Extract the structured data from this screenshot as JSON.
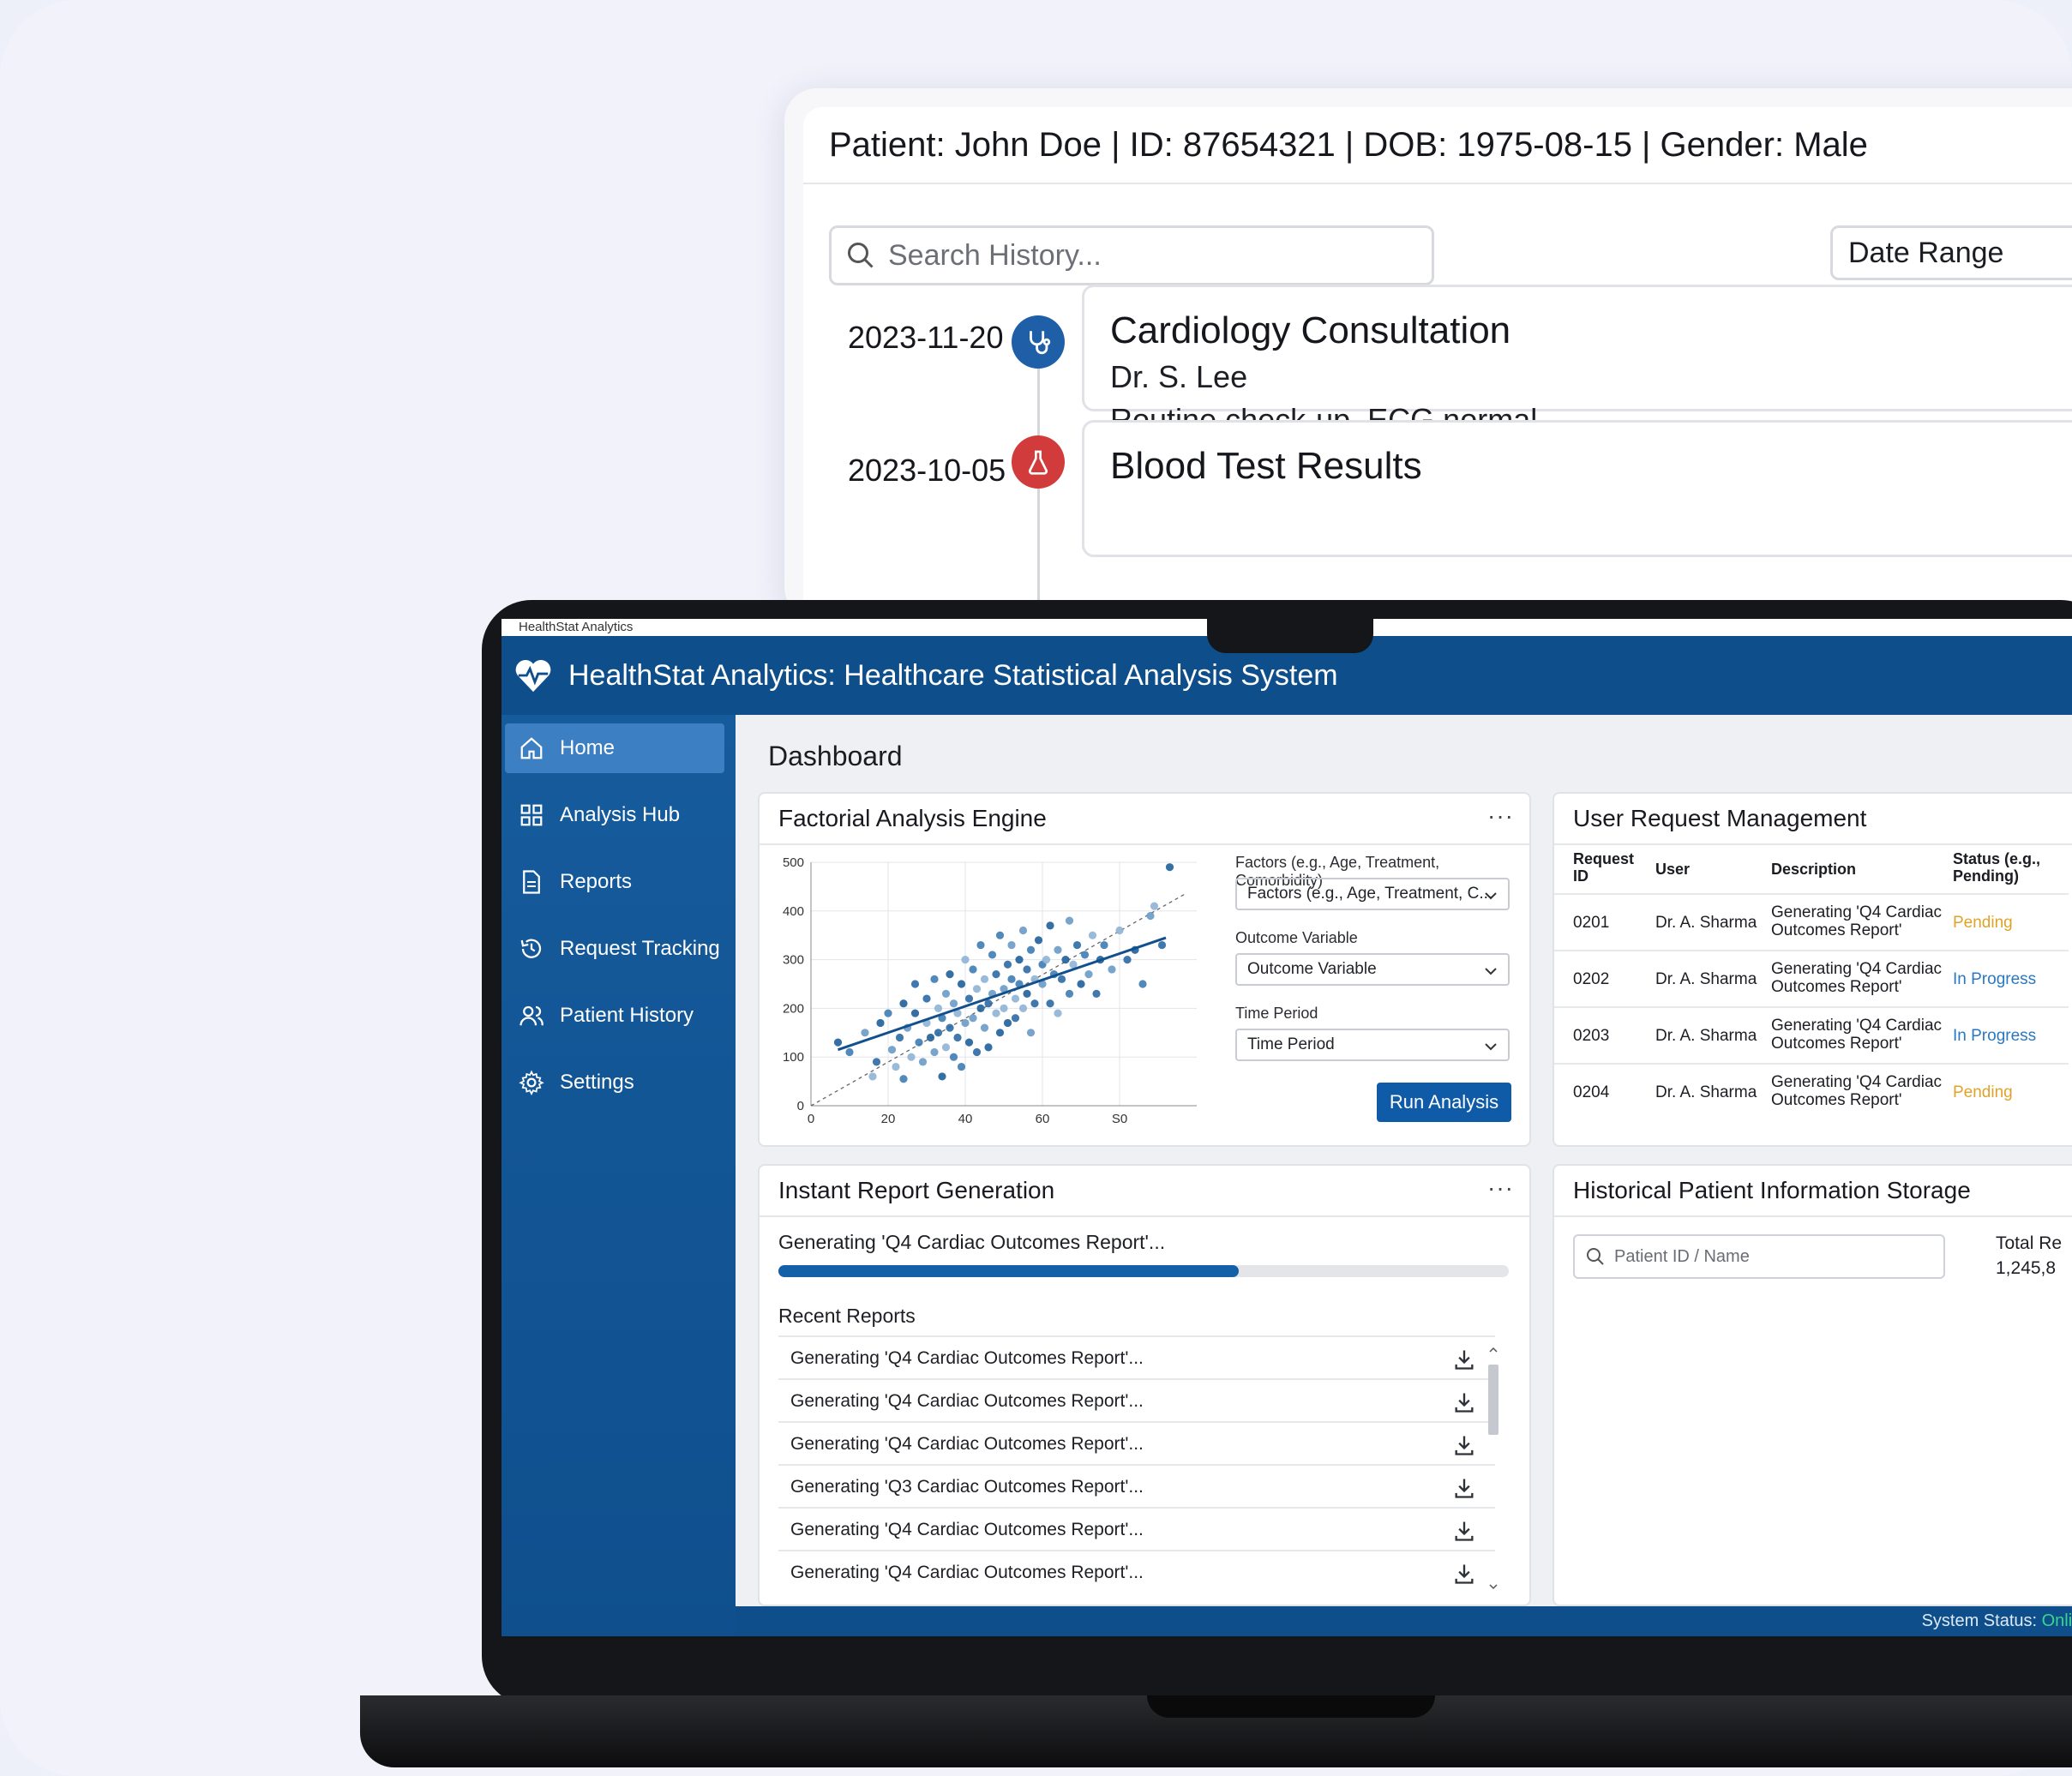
{
  "history": {
    "patient_header": "Patient: John Doe | ID: 87654321 | DOB: 1975-08-15 | Gender: Male",
    "search_placeholder": "Search History...",
    "date_range_label": "Date Range",
    "events": [
      {
        "date": "2023-11-20",
        "icon": "stethoscope-icon",
        "icon_color": "#1f5fa8",
        "title": "Cardiology Consultation",
        "doctor": "Dr. S. Lee",
        "note": "Routine check-up, ECG normal."
      },
      {
        "date": "2023-10-05",
        "icon": "flask-icon",
        "icon_color": "#d23b3b",
        "title": "Blood Test Results",
        "doctor": "",
        "note": ""
      }
    ]
  },
  "app": {
    "window_caption": "HealthStat Analytics",
    "title": "HealthStat Analytics: Healthcare Statistical Analysis System",
    "nav": [
      {
        "label": "Home",
        "icon": "home-icon",
        "active": true
      },
      {
        "label": "Analysis Hub",
        "icon": "grid-icon",
        "active": false
      },
      {
        "label": "Reports",
        "icon": "document-icon",
        "active": false
      },
      {
        "label": "Request Tracking",
        "icon": "history-icon",
        "active": false
      },
      {
        "label": "Patient History",
        "icon": "users-icon",
        "active": false
      },
      {
        "label": "Settings",
        "icon": "gear-icon",
        "active": false
      }
    ],
    "dashboard_title": "Dashboard",
    "status_label": "System Status:",
    "status_value": "Online"
  },
  "factorial": {
    "title": "Factorial Analysis Engine",
    "menu": "···",
    "factors_label": "Factors (e.g., Age, Treatment, Comorbidity)",
    "factors_value": "Factors (e.g., Age, Treatment, C...",
    "outcome_label": "Outcome Variable",
    "outcome_value": "Outcome Variable",
    "period_label": "Time Period",
    "period_value": "Time Period",
    "run_label": "Run Analysis"
  },
  "chart_data": {
    "type": "scatter",
    "title": "",
    "xlabel": "",
    "ylabel": "",
    "x_ticks": [
      "0",
      "20",
      "40",
      "60",
      "S0"
    ],
    "y_ticks": [
      "0",
      "100",
      "200",
      "300",
      "400",
      "500"
    ],
    "xlim": [
      0,
      100
    ],
    "ylim": [
      0,
      500
    ],
    "grid": true,
    "trend_line": {
      "x": [
        7,
        92
      ],
      "y": [
        115,
        345
      ]
    },
    "reference_line": {
      "x": [
        0,
        97
      ],
      "y": [
        0,
        435
      ]
    },
    "points": [
      [
        7,
        130
      ],
      [
        10,
        110
      ],
      [
        14,
        150
      ],
      [
        16,
        60
      ],
      [
        17,
        90
      ],
      [
        18,
        170
      ],
      [
        20,
        190
      ],
      [
        21,
        115
      ],
      [
        22,
        80
      ],
      [
        23,
        140
      ],
      [
        24,
        210
      ],
      [
        24,
        55
      ],
      [
        25,
        160
      ],
      [
        26,
        100
      ],
      [
        27,
        250
      ],
      [
        27,
        190
      ],
      [
        28,
        130
      ],
      [
        29,
        90
      ],
      [
        30,
        170
      ],
      [
        30,
        220
      ],
      [
        31,
        140
      ],
      [
        32,
        260
      ],
      [
        32,
        110
      ],
      [
        33,
        200
      ],
      [
        33,
        150
      ],
      [
        34,
        60
      ],
      [
        34,
        180
      ],
      [
        35,
        230
      ],
      [
        35,
        120
      ],
      [
        36,
        160
      ],
      [
        36,
        270
      ],
      [
        37,
        100
      ],
      [
        37,
        210
      ],
      [
        38,
        190
      ],
      [
        38,
        140
      ],
      [
        39,
        250
      ],
      [
        39,
        80
      ],
      [
        40,
        170
      ],
      [
        40,
        300
      ],
      [
        41,
        220
      ],
      [
        41,
        130
      ],
      [
        42,
        280
      ],
      [
        42,
        180
      ],
      [
        43,
        240
      ],
      [
        43,
        110
      ],
      [
        44,
        200
      ],
      [
        44,
        330
      ],
      [
        45,
        160
      ],
      [
        45,
        260
      ],
      [
        46,
        210
      ],
      [
        46,
        120
      ],
      [
        47,
        310
      ],
      [
        47,
        230
      ],
      [
        48,
        190
      ],
      [
        48,
        270
      ],
      [
        49,
        150
      ],
      [
        49,
        350
      ],
      [
        50,
        240
      ],
      [
        50,
        200
      ],
      [
        51,
        290
      ],
      [
        51,
        170
      ],
      [
        52,
        260
      ],
      [
        52,
        330
      ],
      [
        53,
        220
      ],
      [
        53,
        180
      ],
      [
        54,
        300
      ],
      [
        54,
        250
      ],
      [
        55,
        360
      ],
      [
        55,
        200
      ],
      [
        56,
        280
      ],
      [
        56,
        230
      ],
      [
        57,
        320
      ],
      [
        57,
        150
      ],
      [
        58,
        260
      ],
      [
        58,
        210
      ],
      [
        59,
        340
      ],
      [
        60,
        290
      ],
      [
        60,
        250
      ],
      [
        61,
        300
      ],
      [
        62,
        210
      ],
      [
        62,
        370
      ],
      [
        63,
        270
      ],
      [
        64,
        320
      ],
      [
        64,
        190
      ],
      [
        65,
        260
      ],
      [
        66,
        300
      ],
      [
        67,
        230
      ],
      [
        67,
        380
      ],
      [
        68,
        290
      ],
      [
        69,
        330
      ],
      [
        70,
        250
      ],
      [
        71,
        310
      ],
      [
        72,
        270
      ],
      [
        73,
        350
      ],
      [
        74,
        230
      ],
      [
        75,
        300
      ],
      [
        76,
        330
      ],
      [
        78,
        280
      ],
      [
        80,
        360
      ],
      [
        82,
        300
      ],
      [
        84,
        320
      ],
      [
        86,
        250
      ],
      [
        88,
        390
      ],
      [
        89,
        410
      ],
      [
        91,
        330
      ],
      [
        93,
        490
      ]
    ]
  },
  "requests": {
    "title": "User Request Management",
    "columns": [
      "Request ID",
      "User",
      "Description",
      "Status (e.g., Pending)"
    ],
    "rows": [
      {
        "id": "0201",
        "user": "Dr. A. Sharma",
        "desc": "Generating 'Q4 Cardiac Outcomes Report'",
        "status": "Pending",
        "kind": "pending"
      },
      {
        "id": "0202",
        "user": "Dr. A. Sharma",
        "desc": "Generating 'Q4 Cardiac Outcomes Report'",
        "status": "In Progress",
        "kind": "prog"
      },
      {
        "id": "0203",
        "user": "Dr. A. Sharma",
        "desc": "Generating 'Q4 Cardiac Outcomes Report'",
        "status": "In Progress",
        "kind": "prog"
      },
      {
        "id": "0204",
        "user": "Dr. A. Sharma",
        "desc": "Generating 'Q4 Cardiac Outcomes Report'",
        "status": "Pending",
        "kind": "pending"
      }
    ],
    "colors": {
      "pending": "#e0a32a",
      "in_progress": "#2a78c2"
    }
  },
  "reports": {
    "title": "Instant Report Generation",
    "menu": "···",
    "progress_text": "Generating 'Q4 Cardiac Outcomes Report'...",
    "progress": 0.63,
    "recent_title": "Recent Reports",
    "items": [
      "Generating 'Q4 Cardiac Outcomes Report'...",
      "Generating 'Q4 Cardiac Outcomes Report'...",
      "Generating 'Q4 Cardiac Outcomes Report'...",
      "Generating 'Q3 Cardiac Outcomes Report'...",
      "Generating 'Q4 Cardiac Outcomes Report'...",
      "Generating 'Q4 Cardiac Outcomes Report'..."
    ]
  },
  "storage": {
    "title": "Historical Patient Information Storage",
    "search_placeholder": "Patient ID / Name",
    "total_label": "Total Re",
    "total_value": "1,245,8"
  }
}
